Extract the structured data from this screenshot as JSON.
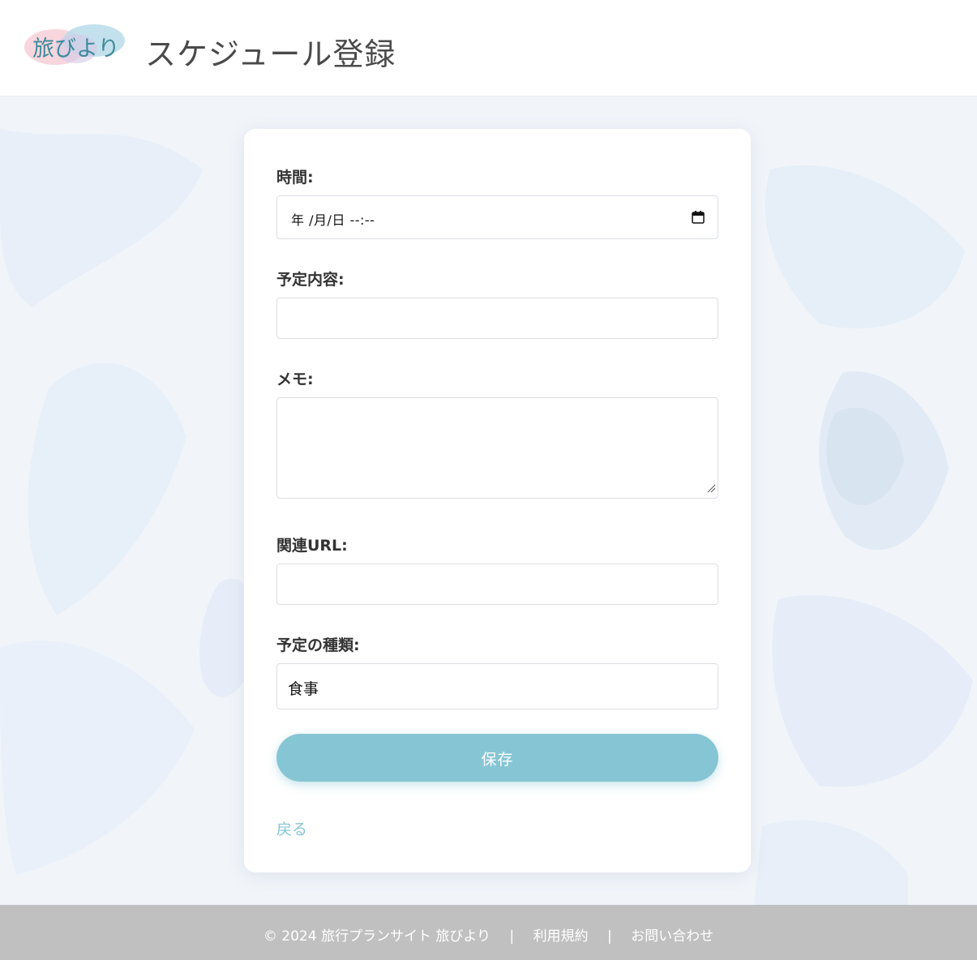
{
  "header": {
    "logo_text": "旅びより",
    "title": "スケジュール登録"
  },
  "form": {
    "time": {
      "label": "時間:",
      "value": "年 /月/日 --:--"
    },
    "content": {
      "label": "予定内容:",
      "value": ""
    },
    "memo": {
      "label": "メモ:",
      "value": ""
    },
    "url": {
      "label": "関連URL:",
      "value": ""
    },
    "type": {
      "label": "予定の種類:",
      "selected": "食事"
    },
    "save_label": "保存",
    "back_label": "戻る"
  },
  "footer": {
    "copyright": "© 2024 旅行プランサイト 旅びより",
    "separator": "|",
    "terms": "利用規約",
    "contact": "お問い合わせ"
  },
  "colors": {
    "accent": "#86c5d4",
    "footer_bg": "#c0c0c0",
    "background": "#f2f6fb"
  },
  "icons": {
    "datetime": "calendar-icon",
    "textarea": "resize-handle-icon"
  }
}
